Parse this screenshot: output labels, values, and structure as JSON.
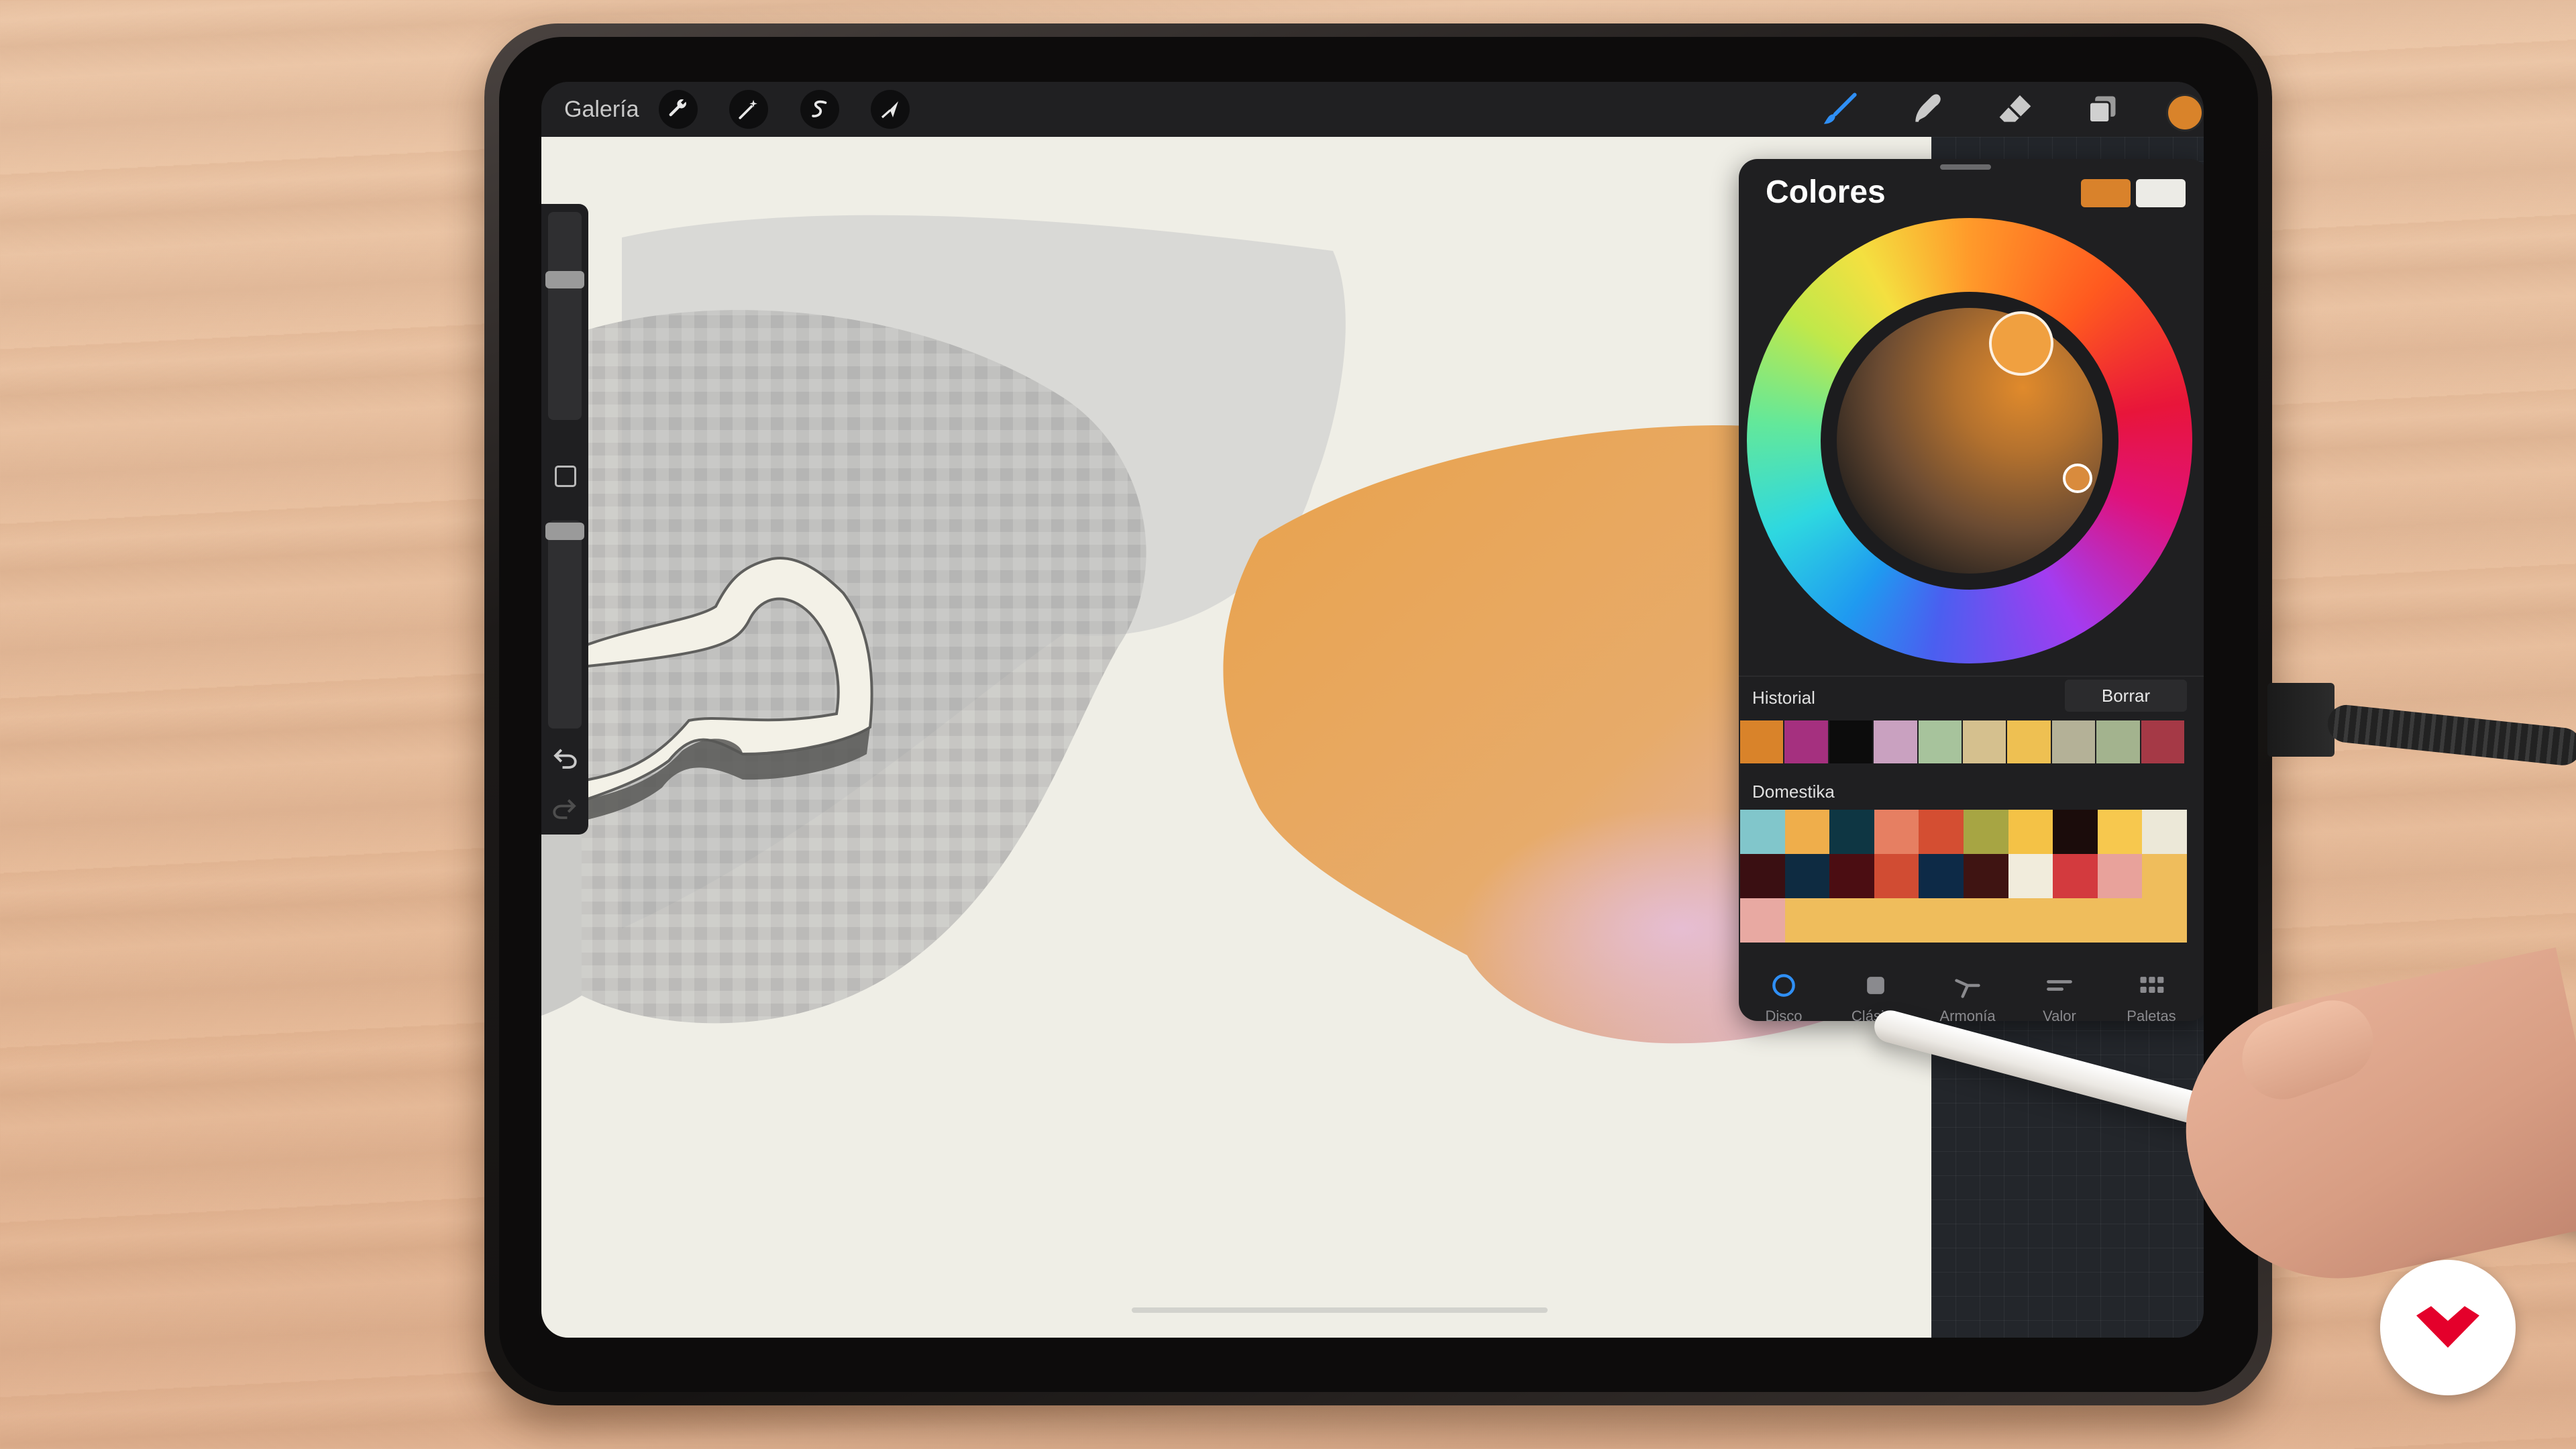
{
  "topbar": {
    "gallery_label": "Galería",
    "left_tools": [
      {
        "name": "actions",
        "icon": "wrench-icon"
      },
      {
        "name": "adjustments",
        "icon": "magic-wand-icon"
      },
      {
        "name": "selection",
        "icon": "selection-s-icon"
      },
      {
        "name": "transform",
        "icon": "arrow-cursor-icon"
      }
    ],
    "right_tools": [
      {
        "name": "brush",
        "icon": "brush-icon",
        "active": true
      },
      {
        "name": "smudge",
        "icon": "smudge-icon"
      },
      {
        "name": "eraser",
        "icon": "eraser-icon"
      },
      {
        "name": "layers",
        "icon": "layers-icon"
      }
    ],
    "current_color": "#d9832a"
  },
  "color_panel": {
    "title": "Colores",
    "primary_color": "#d9822b",
    "secondary_color": "#ecebe6",
    "history_label": "Historial",
    "clear_label": "Borrar",
    "history_colors": [
      "#d9832a",
      "#a5307f",
      "#0c0c0c",
      "#c9a1c0",
      "#a7c39c",
      "#d5c08e",
      "#eec052",
      "#b4b197",
      "#a3b38e",
      "#a53946"
    ],
    "palette_label": "Domestika",
    "palette_colors": [
      "#81c6cb",
      "#efae4b",
      "#0e3643",
      "#e67f62",
      "#d44e32",
      "#a7a543",
      "#f4c246",
      "#1b0c0b",
      "#f7c84e",
      "#ece8d8",
      "#3a0f12",
      "#0e2b41",
      "#4b0d12",
      "#d14c33",
      "#0d2a47",
      "#3f1412",
      "#f1ecdc",
      "#d33a3e",
      "#e8a29b",
      "#efbd5c",
      "#e8a9a2",
      "#efbd5c",
      "#efbd5c",
      "#efbd5c",
      "#efbd5c",
      "#efbd5c",
      "#efbd5c",
      "#efbd5c",
      "#efbd5c",
      "#efbd5c"
    ],
    "tabs": [
      {
        "label": "Disco",
        "icon": "disc-icon",
        "active": true
      },
      {
        "label": "Clásico",
        "icon": "square-icon",
        "active": false
      },
      {
        "label": "Armonía",
        "icon": "harmony-icon",
        "active": false
      },
      {
        "label": "Valor",
        "icon": "sliders-icon",
        "active": false
      },
      {
        "label": "Paletas",
        "icon": "grid-icon",
        "active": false
      }
    ]
  }
}
